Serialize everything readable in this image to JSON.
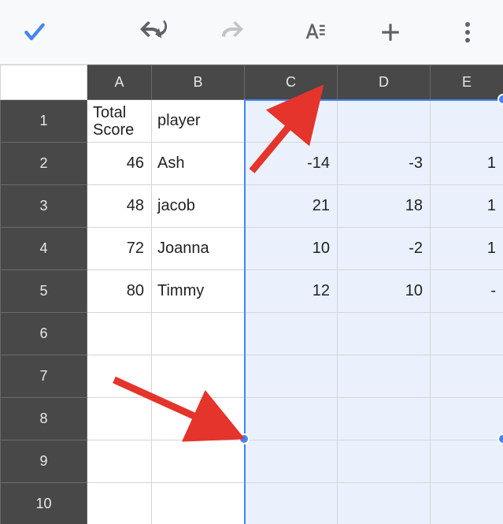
{
  "toolbar": {
    "confirm": "check-icon",
    "undo": "undo-icon",
    "redo": "redo-icon",
    "format": "text-format-icon",
    "add": "plus-icon",
    "more": "more-vert-icon"
  },
  "columns": [
    "A",
    "B",
    "C",
    "D",
    "E"
  ],
  "rows": [
    "1",
    "2",
    "3",
    "4",
    "5",
    "6",
    "7",
    "8",
    "9",
    "10"
  ],
  "cells": {
    "A1": "Total Score",
    "B1": "player",
    "A2": "46",
    "B2": "Ash",
    "C2": "-14",
    "D2": "-3",
    "E2": "1",
    "A3": "48",
    "B3": "jacob",
    "C3": "21",
    "D3": "18",
    "E3": "1",
    "A4": "72",
    "B4": "Joanna",
    "C4": "10",
    "D4": "-2",
    "E4": "1",
    "A5": "80",
    "B5": "Timmy",
    "C5": "12",
    "D5": "10",
    "E5": "-"
  },
  "selection": {
    "start": "C1",
    "end_visible": "E10"
  },
  "annotations": [
    {
      "type": "arrow",
      "target": "column-header-C"
    },
    {
      "type": "arrow",
      "target": "selection-handle-bottom-left"
    }
  ],
  "chart_data": {
    "type": "table",
    "title": "",
    "columns": [
      "Total Score",
      "player",
      "C",
      "D",
      "E"
    ],
    "rows": [
      {
        "Total Score": 46,
        "player": "Ash",
        "C": -14,
        "D": -3,
        "E": 1
      },
      {
        "Total Score": 48,
        "player": "jacob",
        "C": 21,
        "D": 18,
        "E": 1
      },
      {
        "Total Score": 72,
        "player": "Joanna",
        "C": 10,
        "D": -2,
        "E": 1
      },
      {
        "Total Score": 80,
        "player": "Timmy",
        "C": 12,
        "D": 10,
        "E": null
      }
    ]
  }
}
